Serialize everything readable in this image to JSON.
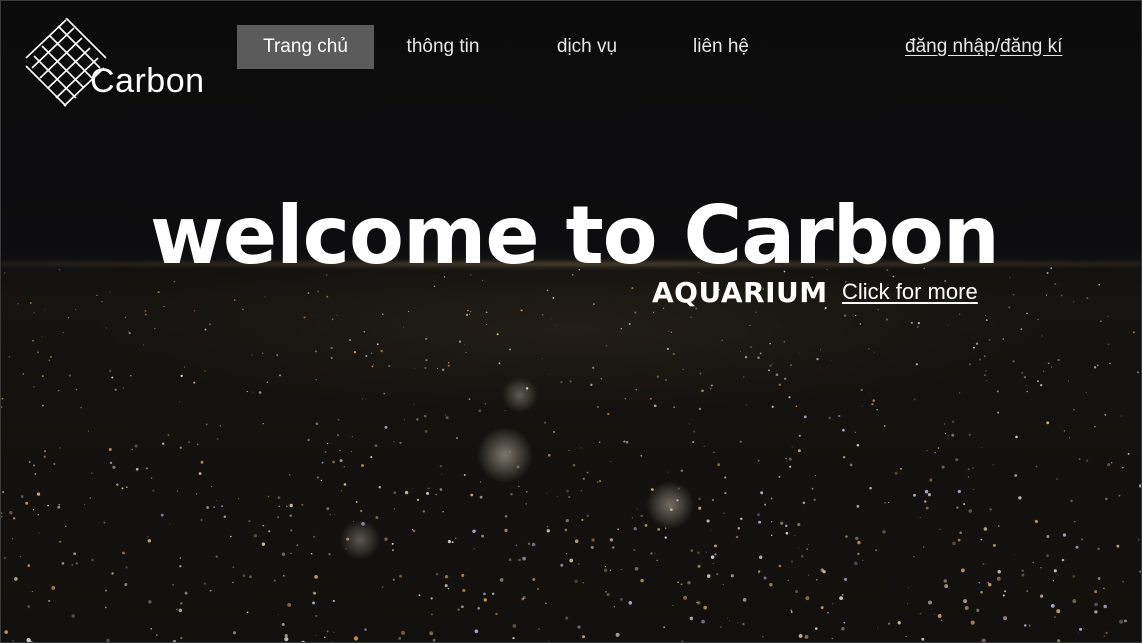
{
  "logo": {
    "text": "Carbon",
    "icon": "diagonal-grid-icon"
  },
  "nav": {
    "items": [
      {
        "label": "Trang chủ",
        "active": true
      },
      {
        "label": "thông tin",
        "active": false
      },
      {
        "label": "dịch vụ",
        "active": false
      },
      {
        "label": "liên hệ",
        "active": false
      }
    ],
    "login_label": "đăng nhập",
    "separator": "/",
    "register_label": "đăng kí"
  },
  "hero": {
    "title": "welcome to Carbon",
    "subtitle": "AQUARIUM",
    "cta_label": "Click for more"
  },
  "colors": {
    "background": "#0a0a0b",
    "active_nav_bg": "#5b5b5b",
    "text": "#ffffff"
  }
}
